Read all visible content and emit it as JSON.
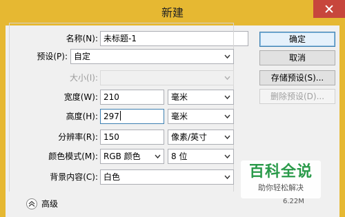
{
  "window": {
    "title": "新建"
  },
  "form": {
    "name_label": "名称(N):",
    "name_value": "未标题-1",
    "preset_label": "预设(P):",
    "preset_value": "自定",
    "size_label": "大小(I):",
    "size_value": "",
    "width_label": "宽度(W):",
    "width_value": "210",
    "width_unit": "毫米",
    "height_label": "高度(H):",
    "height_value": "297",
    "height_unit": "毫米",
    "resolution_label": "分辨率(R):",
    "resolution_value": "150",
    "resolution_unit": "像素/英寸",
    "color_mode_label": "颜色模式(M):",
    "color_mode_value": "RGB 颜色",
    "bit_depth_value": "8 位",
    "background_label": "背景内容(C):",
    "background_value": "白色",
    "advanced_label": "高级"
  },
  "buttons": {
    "ok": "确定",
    "cancel": "取消",
    "save_preset": "存储预设(S)...",
    "delete_preset": "删除预设(D)..."
  },
  "watermark": {
    "title": "百科全说",
    "subtitle": "助你轻松解决"
  },
  "info_text": "6.22M",
  "icons": {
    "close": "close-icon",
    "chevron": "chevron-down-icon",
    "advanced": "chevron-up-double-icon"
  },
  "colors": {
    "titlebar": "#e6b832",
    "close": "#c7463c",
    "watermark": "#2a9a4a"
  }
}
